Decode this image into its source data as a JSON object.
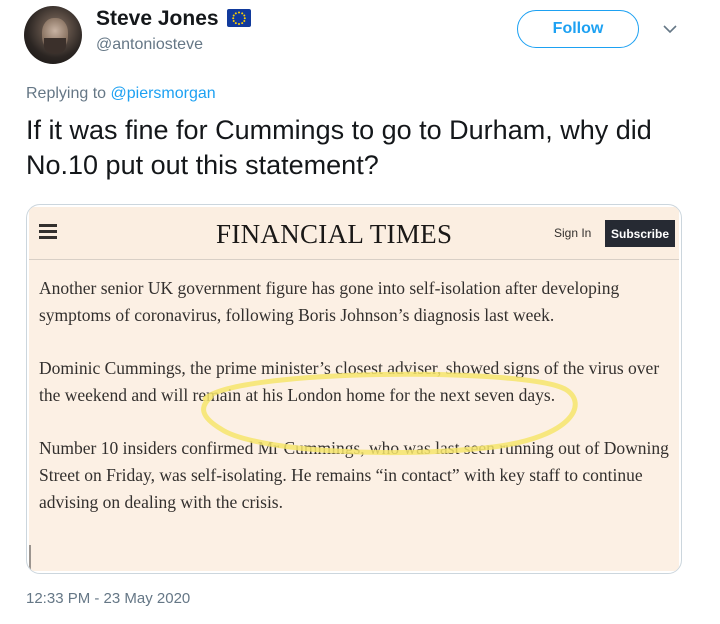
{
  "author": {
    "name": "Steve Jones",
    "handle": "@antoniosteve",
    "avatar_icon": "user-avatar",
    "badge_icon": "eu-flag-icon"
  },
  "header": {
    "follow_label": "Follow",
    "menu_icon": "chevron-down-icon"
  },
  "reply": {
    "prefix": "Replying to ",
    "mention": "@piersmorgan"
  },
  "tweet": {
    "text": "If it was fine for Cummings to go to Durham, why did No.10 put out this statement?",
    "timestamp": "12:33 PM - 23 May 2020"
  },
  "ft_card": {
    "logo": "FINANCIAL TIMES",
    "sign_in": "Sign In",
    "subscribe": "Subscribe",
    "menu_icon": "hamburger-menu-icon",
    "paragraphs": [
      "Another senior UK government figure has gone into self-isolation after developing symptoms of coronavirus, following Boris Johnson’s diagnosis last week.",
      "Dominic Cummings, the prime minister’s closest adviser, showed signs of the virus over the weekend and will remain at his London home for the next seven days.",
      "Number 10 insiders confirmed Mr Cummings, who was last seen running out of Downing Street on Friday, was self-isolating. He remains “in contact” with key staff to continue advising on dealing with the crisis."
    ],
    "colors": {
      "background": "#fcf0e4",
      "highlight": "#f6e56c"
    }
  },
  "colors": {
    "accent": "#1da1f2",
    "muted": "#657786",
    "text": "#14171a"
  }
}
